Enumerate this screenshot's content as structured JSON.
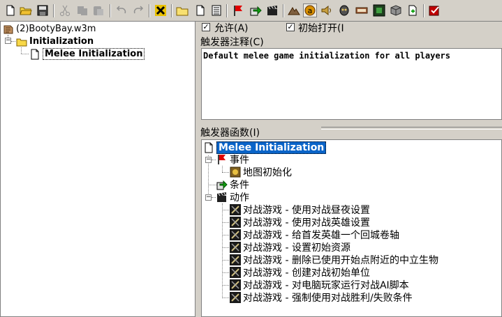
{
  "toolbar": {
    "buttons": [
      {
        "name": "new-document-icon"
      },
      {
        "name": "open-folder-icon"
      },
      {
        "name": "save-icon"
      },
      {
        "name": "cut-icon"
      },
      {
        "name": "copy-icon"
      },
      {
        "name": "paste-icon"
      },
      {
        "name": "undo-icon"
      },
      {
        "name": "redo-icon"
      },
      {
        "name": "delete-x-icon"
      },
      {
        "name": "new-category-icon"
      },
      {
        "name": "new-trigger-icon"
      },
      {
        "name": "new-comment-icon"
      },
      {
        "name": "new-event-flag-icon"
      },
      {
        "name": "new-condition-icon"
      },
      {
        "name": "new-action-icon"
      },
      {
        "name": "terrain-editor-icon"
      },
      {
        "name": "trigger-editor-icon"
      },
      {
        "name": "sound-editor-icon"
      },
      {
        "name": "object-editor-icon"
      },
      {
        "name": "campaign-editor-icon"
      },
      {
        "name": "ai-editor-icon"
      },
      {
        "name": "object-manager-icon"
      },
      {
        "name": "import-manager-icon"
      },
      {
        "name": "test-map-icon"
      }
    ]
  },
  "tree": {
    "map_file": "(2)BootyBay.w3m",
    "category": "Initialization",
    "trigger": "Melee Initialization"
  },
  "trigger_panel": {
    "enabled_label": "允许(A)",
    "initially_on_label": "初始打开(I",
    "comment_header": "触发器注释(C)",
    "comment_text": "Default melee game initialization for all players",
    "functions_header": "触发器函数(I)"
  },
  "functions": {
    "root": "Melee Initialization",
    "events_label": "事件",
    "event_items": [
      "地图初始化"
    ],
    "conditions_label": "条件",
    "actions_label": "动作",
    "action_items": [
      "对战游戏 - 使用对战昼夜设置",
      "对战游戏 - 使用对战英雄设置",
      "对战游戏 - 给首发英雄一个回城卷轴",
      "对战游戏 - 设置初始资源",
      "对战游戏 - 删除已使用开始点附近的中立生物",
      "对战游戏 - 创建对战初始单位",
      "对战游戏 - 对电脑玩家运行对战AI脚本",
      "对战游戏 - 强制使用对战胜利/失败条件"
    ]
  }
}
